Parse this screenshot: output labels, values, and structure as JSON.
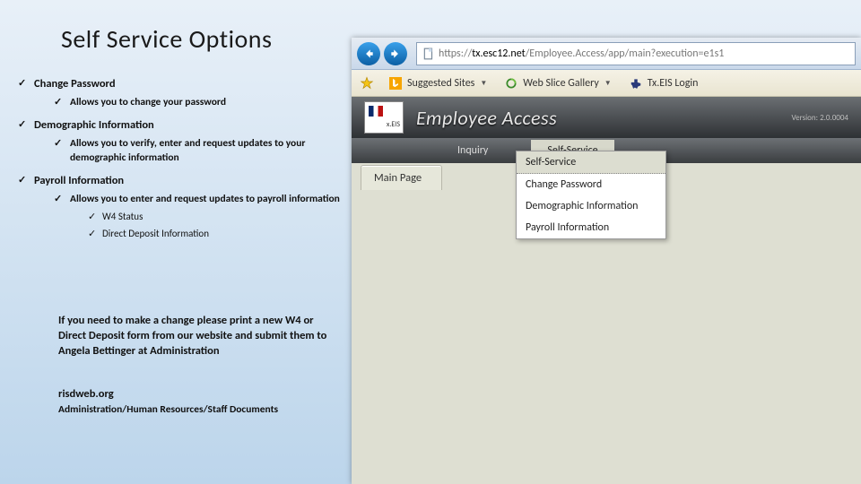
{
  "slide_title": "Self Service Options",
  "bullets": {
    "item1": {
      "title": "Change Password",
      "sub1": "Allows you to change your password"
    },
    "item2": {
      "title": "Demographic Information",
      "sub1": "Allows you to verify, enter and request updates to your demographic information"
    },
    "item3": {
      "title": "Payroll Information",
      "sub1": "Allows you to enter and request updates to payroll information",
      "subs": {
        "a": "W4 Status",
        "b": "Direct Deposit Information"
      }
    }
  },
  "note": "If you need to make a change please print a new W4 or Direct Deposit form from our website and submit them to Angela Bettinger at Administration",
  "site": "risdweb.org",
  "sitepath": "Administration/Human Resources/Staff Documents",
  "browser": {
    "url_prefix": "https://",
    "url_host": "tx.esc12.net",
    "url_path": "/Employee.Access/app/main?execution=e1s1",
    "fav1": "Suggested Sites",
    "fav2": "Web Slice Gallery",
    "fav3": "Tx.EIS Login"
  },
  "app": {
    "title": "Employee Access",
    "version": "Version: 2.0.0004",
    "menu1": "Inquiry",
    "menu2": "Self-Service",
    "pagetab": "Main Page",
    "dd_head": "Self-Service",
    "dd1": "Change Password",
    "dd2": "Demographic Information",
    "dd3": "Payroll Information"
  }
}
